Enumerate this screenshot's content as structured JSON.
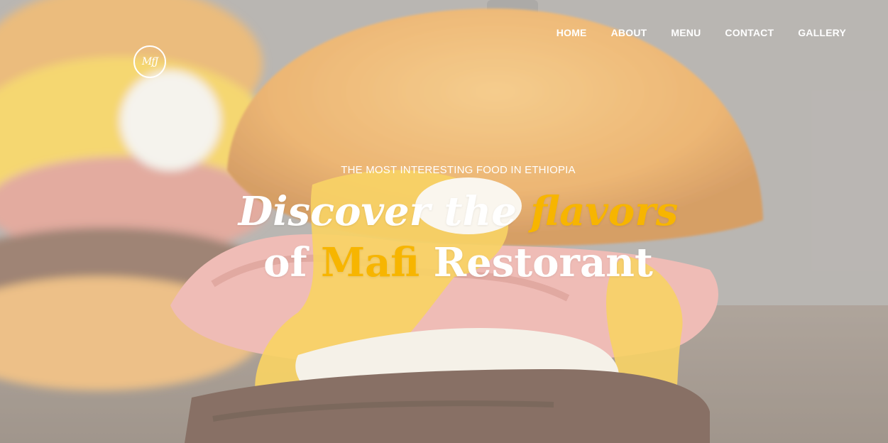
{
  "nav": {
    "items": [
      {
        "label": "HOME"
      },
      {
        "label": "ABOUT"
      },
      {
        "label": "MENU"
      },
      {
        "label": "CONTACT"
      },
      {
        "label": "GALLERY"
      }
    ]
  },
  "logo": {
    "text": "MfJ"
  },
  "hero": {
    "eyebrow": "THE MOST INTERESTING FOOD IN ETHIOPIA",
    "line1_part1": "Discover the ",
    "line1_accent": "flavors",
    "line2_part1": "of ",
    "line2_accent": "Mafi",
    "line2_part2": " Restorant"
  },
  "colors": {
    "accent": "#f7b500",
    "text": "#ffffff"
  }
}
